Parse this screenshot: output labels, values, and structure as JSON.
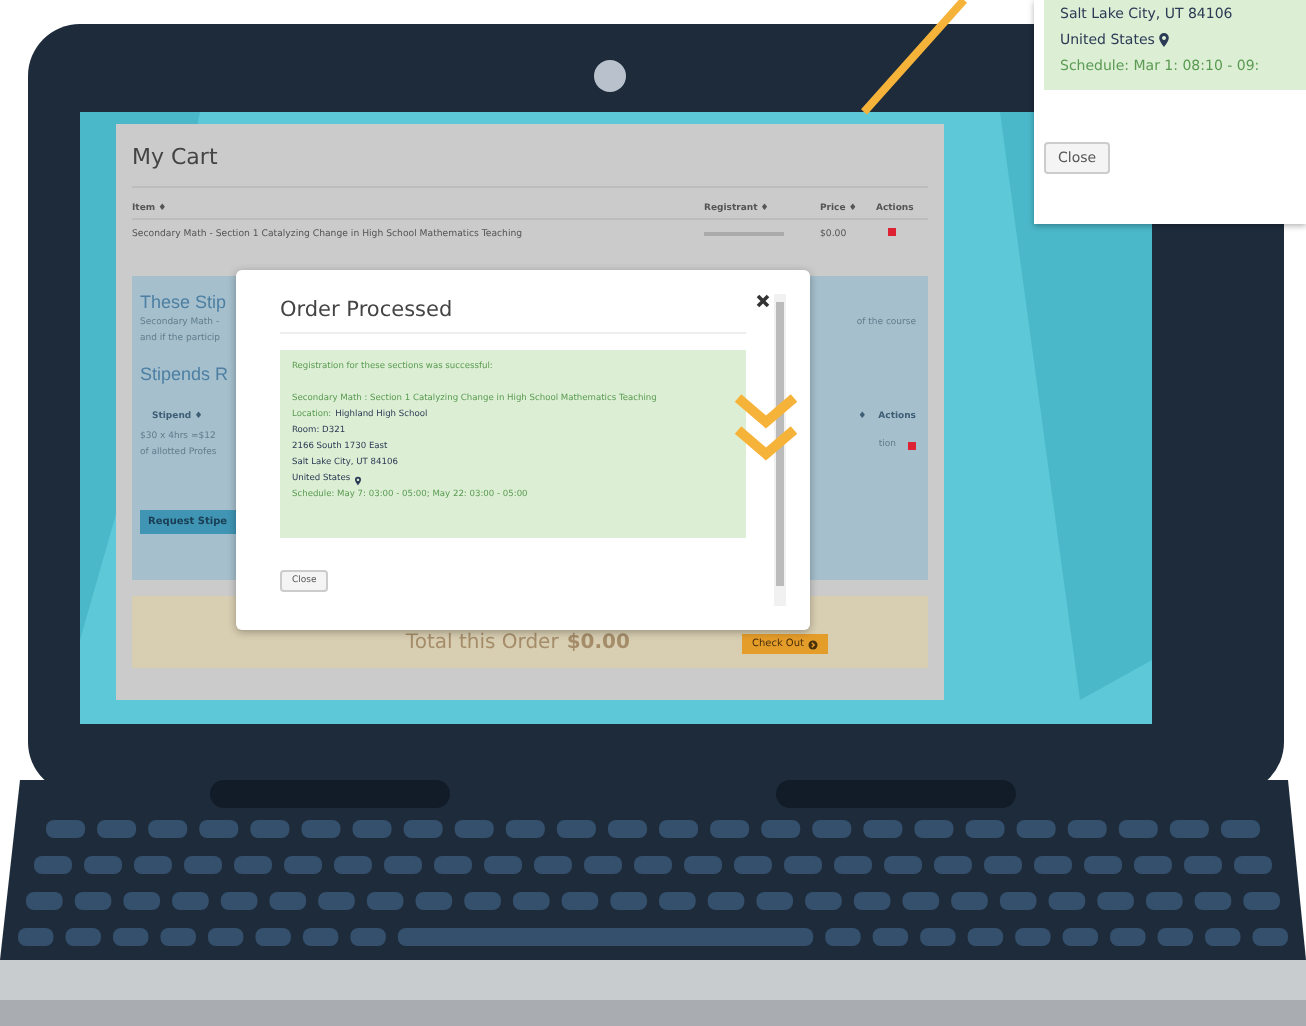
{
  "cart": {
    "title": "My Cart",
    "columns": [
      {
        "label": "Item ♦"
      },
      {
        "label": "Registrant ♦"
      },
      {
        "label": "Price ♦"
      },
      {
        "label": "Actions"
      }
    ],
    "rows": [
      {
        "item": "Secondary Math  - Section 1 Catalyzing Change in High School Mathematics Teaching",
        "price": "$0.00"
      }
    ]
  },
  "stipends": {
    "heading": "These Stip",
    "text_left": [
      "Secondary Math -",
      "and if the particip"
    ],
    "text_right": [
      "of the course"
    ],
    "subheading": "Stipends R",
    "column": "Stipend ♦",
    "cell_lines": [
      "$30 x 4hrs =$12",
      "of allotted Profes"
    ],
    "right_columns": [
      "♦",
      "Actions"
    ],
    "right_cell": "tion",
    "button": "Request Stipe"
  },
  "total": {
    "label": "Total this Order",
    "amount": "$0.00",
    "button": "Check Out"
  },
  "modal": {
    "title": "Order Processed",
    "lines": [
      {
        "kind": "note",
        "text": "Registration for these sections was successful:"
      },
      {
        "kind": "gap"
      },
      {
        "kind": "note",
        "text": "Secondary Math : Section 1 Catalyzing Change in High School Mathematics Teaching"
      },
      {
        "kind": "field",
        "label": "Location:",
        "text": "Highland High School"
      },
      {
        "kind": "address",
        "text": "Room: D321"
      },
      {
        "kind": "address",
        "text": "2166 South 1730 East"
      },
      {
        "kind": "address",
        "text": "Salt Lake City, UT 84106"
      },
      {
        "kind": "pin",
        "text": "United States"
      },
      {
        "kind": "note",
        "text": "Schedule: May 7: 03:00 - 05:00; May 22: 03:00 - 05:00"
      }
    ],
    "button": "Close"
  },
  "callout": {
    "lines": [
      {
        "kind": "address",
        "text": "Salt Lake City, UT 84106"
      },
      {
        "kind": "pin",
        "text": "United States"
      },
      {
        "kind": "note",
        "text": "Schedule: Mar 1: 08:10 - 09:"
      }
    ],
    "button": "Close"
  }
}
